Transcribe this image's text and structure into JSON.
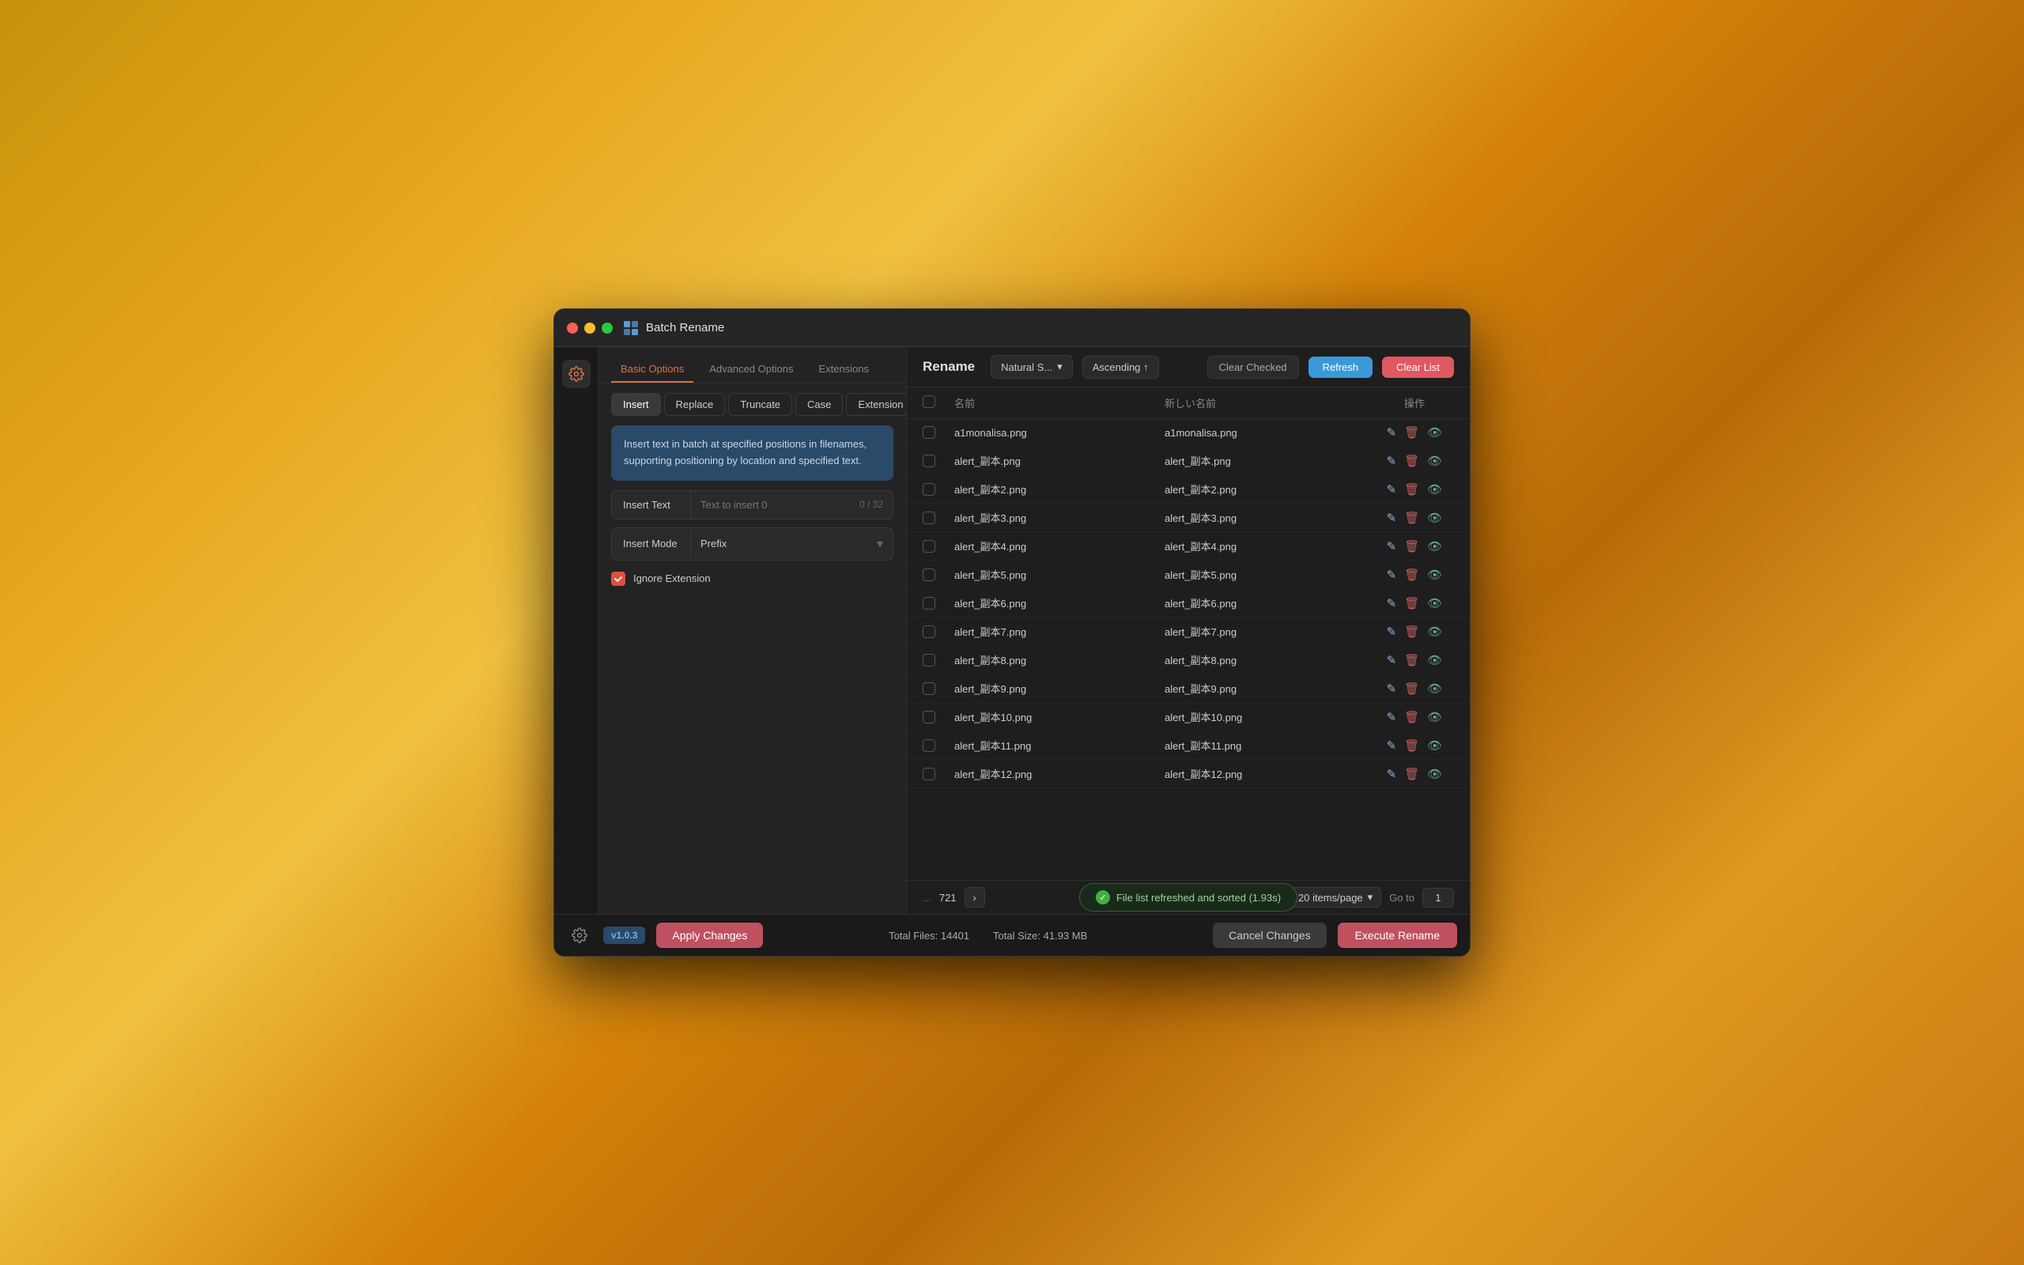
{
  "window": {
    "title": "Batch Rename"
  },
  "traffic_lights": {
    "red": "#ff5f56",
    "yellow": "#ffbd2e",
    "green": "#27c93f"
  },
  "left_panel": {
    "main_tabs": [
      {
        "label": "Basic Options",
        "active": true
      },
      {
        "label": "Advanced Options",
        "active": false
      },
      {
        "label": "Extensions",
        "active": false
      }
    ],
    "options_tabs": [
      {
        "label": "Insert",
        "active": true
      },
      {
        "label": "Replace",
        "active": false
      },
      {
        "label": "Truncate",
        "active": false
      },
      {
        "label": "Case",
        "active": false
      },
      {
        "label": "Extension",
        "active": false
      }
    ],
    "description": "Insert text in batch at specified positions in filenames, supporting positioning by location and specified text.",
    "insert_text_label": "Insert Text",
    "insert_text_placeholder": "Text to insert 0",
    "insert_text_counter": "0 / 32",
    "insert_mode_label": "Insert Mode",
    "insert_mode_value": "Prefix",
    "ignore_extension_label": "Ignore Extension"
  },
  "right_panel": {
    "title": "Rename",
    "sort_label": "Natural S...",
    "sort_order": "Ascending ↑",
    "btn_clear_checked": "Clear Checked",
    "btn_refresh": "Refresh",
    "btn_clear_list": "Clear List",
    "table_headers": {
      "check": "",
      "name": "名前",
      "new_name": "新しい名前",
      "ops": "操作"
    },
    "files": [
      {
        "name": "a1monalisa.png",
        "new_name": "a1monalisa.png"
      },
      {
        "name": "alert_副本.png",
        "new_name": "alert_副本.png"
      },
      {
        "name": "alert_副本2.png",
        "new_name": "alert_副本2.png"
      },
      {
        "name": "alert_副本3.png",
        "new_name": "alert_副本3.png"
      },
      {
        "name": "alert_副本4.png",
        "new_name": "alert_副本4.png"
      },
      {
        "name": "alert_副本5.png",
        "new_name": "alert_副本5.png"
      },
      {
        "name": "alert_副本6.png",
        "new_name": "alert_副本6.png"
      },
      {
        "name": "alert_副本7.png",
        "new_name": "alert_副本7.png"
      },
      {
        "name": "alert_副本8.png",
        "new_name": "alert_副本8.png"
      },
      {
        "name": "alert_副本9.png",
        "new_name": "alert_副本9.png"
      },
      {
        "name": "alert_副本10.png",
        "new_name": "alert_副本10.png"
      },
      {
        "name": "alert_副本11.png",
        "new_name": "alert_副本11.png"
      },
      {
        "name": "alert_副本12.png",
        "new_name": "alert_副本12.png"
      }
    ],
    "pagination": {
      "dots": "...",
      "count": "721",
      "items_per_page": "20 items/page",
      "goto_label": "Go to",
      "goto_value": "1"
    },
    "toast": "File list refreshed and sorted (1.93s)"
  },
  "footer": {
    "version": "v1.0.3",
    "btn_apply": "Apply Changes",
    "total_files": "Total Files: 14401",
    "total_size": "Total Size: 41.93 MB",
    "btn_cancel": "Cancel Changes",
    "btn_execute": "Execute Rename"
  }
}
